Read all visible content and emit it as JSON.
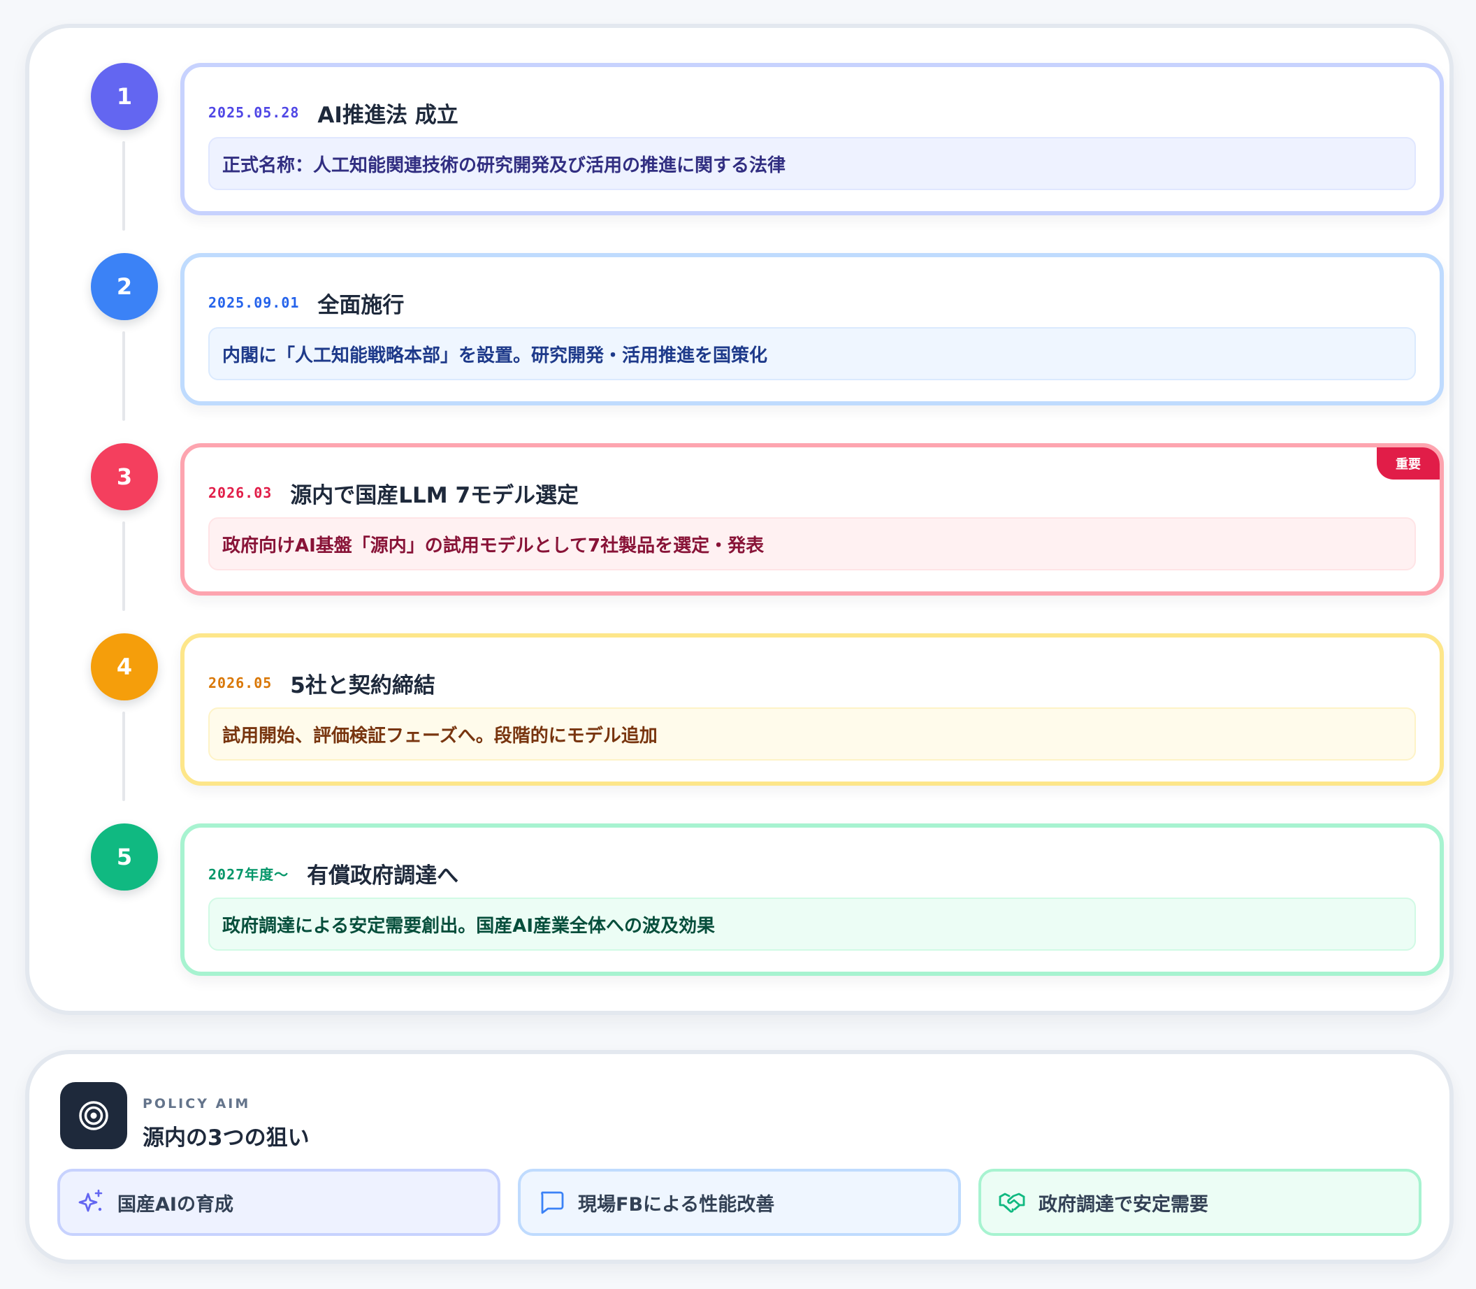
{
  "timeline": {
    "events": [
      {
        "number": "1",
        "date": "2025.05.28",
        "title": "AI推進法 成立",
        "description": "正式名称：人工知能関連技術の研究開発及び活用の推進に関する法律",
        "colors": {
          "accent": "#6366f1",
          "border": "#c7d2fe",
          "date": "#4f46e5",
          "desc_bg": "#eef2ff",
          "desc_border": "#e0e7ff",
          "desc_text": "#312e81"
        }
      },
      {
        "number": "2",
        "date": "2025.09.01",
        "title": "全面施行",
        "description": "内閣に「人工知能戦略本部」を設置。研究開発・活用推進を国策化",
        "colors": {
          "accent": "#3b82f6",
          "border": "#bfdbfe",
          "date": "#2563eb",
          "desc_bg": "#eff6ff",
          "desc_border": "#dbeafe",
          "desc_text": "#1e3a8a"
        }
      },
      {
        "number": "3",
        "date": "2026.03",
        "title": "源内で国産LLM 7モデル選定",
        "description": "政府向けAI基盤「源内」の試用モデルとして7社製品を選定・発表",
        "badge": "重要",
        "colors": {
          "accent": "#f43f5e",
          "border": "#fda4af",
          "date": "#e11d48",
          "desc_bg": "#fff1f2",
          "desc_border": "#ffe4e6",
          "desc_text": "#881337"
        }
      },
      {
        "number": "4",
        "date": "2026.05",
        "title": "5社と契約締結",
        "description": "試用開始、評価検証フェーズへ。段階的にモデル追加",
        "colors": {
          "accent": "#f59e0b",
          "border": "#fde68a",
          "date": "#d97706",
          "desc_bg": "#fffbeb",
          "desc_border": "#fef3c7",
          "desc_text": "#78350f"
        }
      },
      {
        "number": "5",
        "date": "2027年度〜",
        "title": "有償政府調達へ",
        "description": "政府調達による安定需要創出。国産AI産業全体への波及効果",
        "colors": {
          "accent": "#10b981",
          "border": "#a7f3d0",
          "date": "#059669",
          "desc_bg": "#ecfdf5",
          "desc_border": "#d1fae5",
          "desc_text": "#064e3b"
        }
      }
    ]
  },
  "policy": {
    "icon": "target-icon",
    "eyebrow": "POLICY AIM",
    "title": "源内の3つの狙い",
    "aims": [
      {
        "label": "国産AIの育成",
        "icon": "sparkles-icon",
        "colors": {
          "border": "#c7d2fe",
          "bg": "#eef2ff",
          "icon": "#6366f1"
        }
      },
      {
        "label": "現場FBによる性能改善",
        "icon": "chat-bubble-icon",
        "colors": {
          "border": "#bfdbfe",
          "bg": "#eff6ff",
          "icon": "#3b82f6"
        }
      },
      {
        "label": "政府調達で安定需要",
        "icon": "handshake-icon",
        "colors": {
          "border": "#a7f3d0",
          "bg": "#ecfdf5",
          "icon": "#10b981"
        }
      }
    ]
  }
}
